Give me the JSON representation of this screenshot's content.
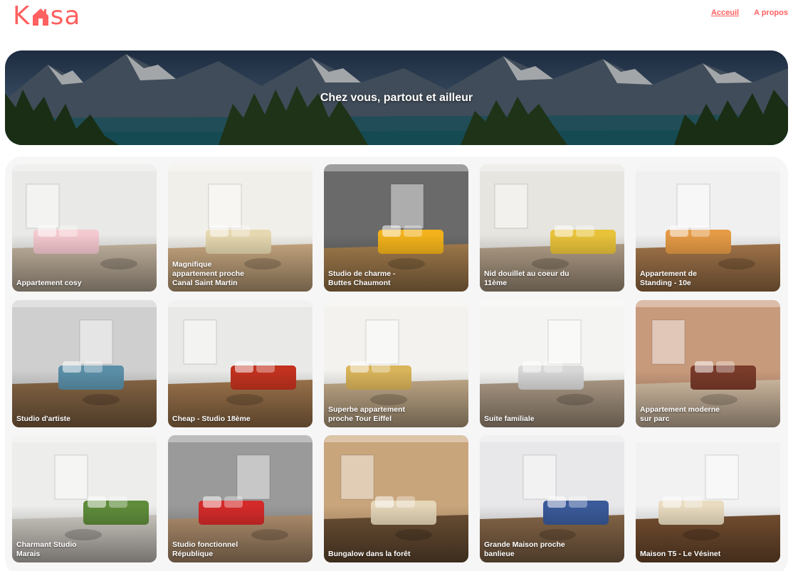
{
  "brand": {
    "name": "Kasa",
    "accent": "#ff6060"
  },
  "nav": [
    {
      "label": "Acceuil",
      "active": true
    },
    {
      "label": "A propos",
      "active": false
    }
  ],
  "banner": {
    "title": "Chez vous, partout et ailleur"
  },
  "listings": [
    {
      "title": "Appartement cosy",
      "wall": "#e9e9e7",
      "floor": "#c9b9a4",
      "accent": "#f4c9cf",
      "icon": "sofa-icon"
    },
    {
      "title": "Magnifique appartement proche Canal Saint Martin",
      "wall": "#f1efe9",
      "floor": "#cfae85",
      "accent": "#e6d8b0",
      "icon": "sofa-icon"
    },
    {
      "title": "Studio de charme - Buttes Chaumont",
      "wall": "#6a6a6a",
      "floor": "#a8804f",
      "accent": "#f2b21b",
      "icon": "bed-icon"
    },
    {
      "title": "Nid douillet au coeur du 11ème",
      "wall": "#e7e5e0",
      "floor": "#b8a48c",
      "accent": "#e8c33a",
      "icon": "sofa-icon"
    },
    {
      "title": "Appartement de Standing - 10e",
      "wall": "#f0f0f0",
      "floor": "#a97a4d",
      "accent": "#e59a46",
      "icon": "table-icon"
    },
    {
      "title": "Studio d'artiste",
      "wall": "#cfcfcf",
      "floor": "#8c6a48",
      "accent": "#5b8fa8",
      "icon": "bed-icon"
    },
    {
      "title": "Cheap - Studio 18ème",
      "wall": "#e9eae8",
      "floor": "#a3794f",
      "accent": "#c2321f",
      "icon": "kitchen-icon"
    },
    {
      "title": "Superbe appartement proche Tour Eiffel",
      "wall": "#f3f2ef",
      "floor": "#c9b08e",
      "accent": "#d9b45a",
      "icon": "sofa-icon"
    },
    {
      "title": "Suite familiale",
      "wall": "#f4f4f2",
      "floor": "#b3a08a",
      "accent": "#d8d8d8",
      "icon": "bed-icon"
    },
    {
      "title": "Appartement moderne sur parc",
      "wall": "#c89a7c",
      "floor": "#d8c2a8",
      "accent": "#7a3b2a",
      "icon": "sofa-icon"
    },
    {
      "title": "Charmant Studio Marais",
      "wall": "#ededeb",
      "floor": "#d4cfc8",
      "accent": "#5f8c3a",
      "icon": "plant-icon"
    },
    {
      "title": "Studio fonctionnel République",
      "wall": "#9a9a9a",
      "floor": "#b59371",
      "accent": "#d42a2a",
      "icon": "bed-icon"
    },
    {
      "title": "Bungalow dans la forêt",
      "wall": "#c9a57b",
      "floor": "#6e5135",
      "accent": "#e5d6b8",
      "icon": "ladder-icon"
    },
    {
      "title": "Grande Maison proche banlieue",
      "wall": "#e8e8ea",
      "floor": "#8a6a4b",
      "accent": "#3a5a9a",
      "icon": "table-icon"
    },
    {
      "title": "Maison T5 - Le Vésinet",
      "wall": "#f2f2f2",
      "floor": "#7a5232",
      "accent": "#e9dcc0",
      "icon": "chair-icon"
    }
  ]
}
